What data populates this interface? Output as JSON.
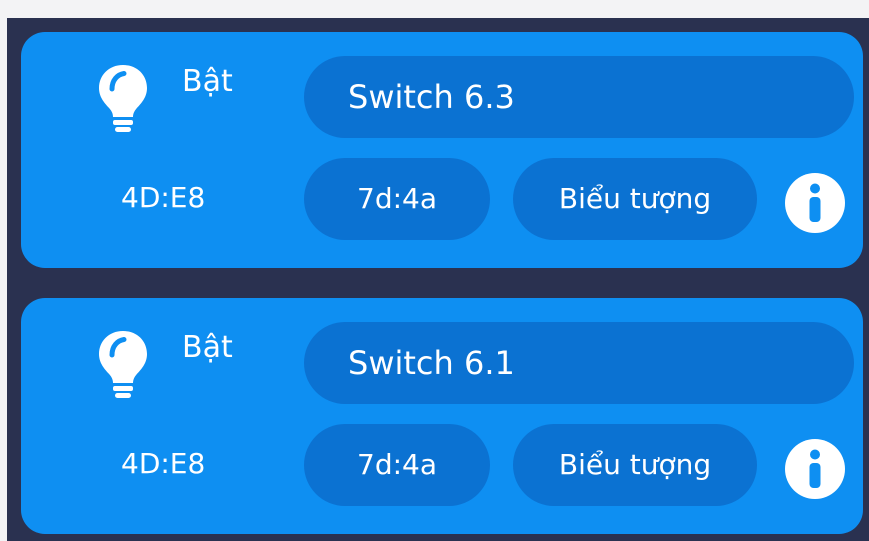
{
  "devices": [
    {
      "status": "Bật",
      "name": "Switch 6.3",
      "mac": "4D:E8",
      "code": "7d:4a",
      "icon_label": "Biểu tượng",
      "bulb_icon": "lightbulb-icon",
      "info_icon": "info-icon"
    },
    {
      "status": "Bật",
      "name": "Switch 6.1",
      "mac": "4D:E8",
      "code": "7d:4a",
      "icon_label": "Biểu tượng",
      "bulb_icon": "lightbulb-icon",
      "info_icon": "info-icon"
    }
  ],
  "colors": {
    "background": "#2a3150",
    "card": "#0e8ff2",
    "pill": "#0b72d2",
    "text": "#ffffff"
  }
}
